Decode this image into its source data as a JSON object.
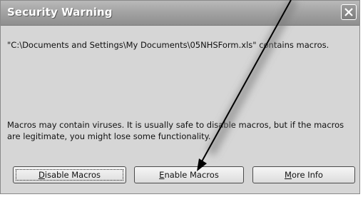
{
  "dialog": {
    "title": "Security Warning",
    "close_icon": "close-icon",
    "message": "\"C:\\Documents and Settings\\My Documents\\05NHSForm.xls\" contains macros.",
    "warning": "Macros may contain viruses. It is usually safe to disable macros, but if the macros are legitimate, you might lose some functionality."
  },
  "buttons": {
    "disable": {
      "mnemonic": "D",
      "rest": "isable Macros"
    },
    "enable": {
      "mnemonic": "E",
      "rest": "nable Macros"
    },
    "more": {
      "mnemonic": "M",
      "rest": "ore Info"
    }
  },
  "annotation": {
    "arrow_icon": "arrow-pointer-icon",
    "color": "#000000"
  }
}
